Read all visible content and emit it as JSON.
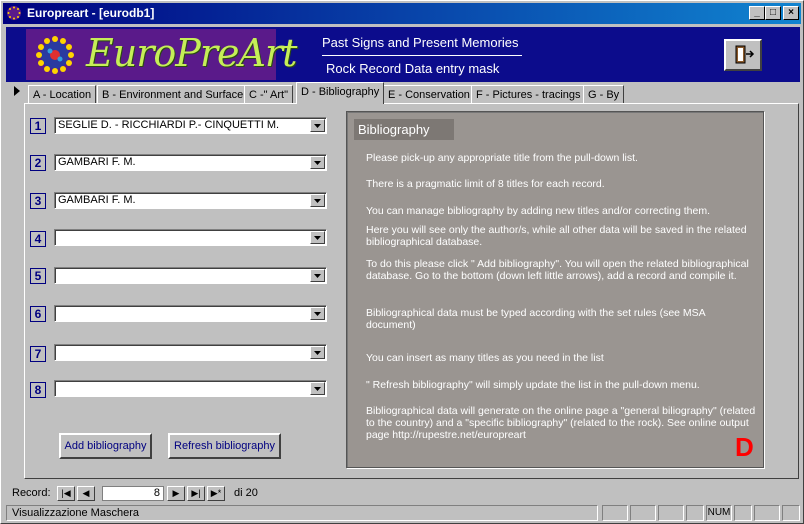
{
  "window": {
    "title": "Europreart - [eurodb1]"
  },
  "banner": {
    "logo_text": "EuroPreArt",
    "line1": "Past Signs and Present Memories",
    "line2": "Rock Record Data entry mask"
  },
  "tabs": [
    {
      "label": "A - Location"
    },
    {
      "label": "B - Environment and Surface"
    },
    {
      "label": "C -\" Art\""
    },
    {
      "label": "D - Bibliography",
      "active": true
    },
    {
      "label": "E - Conservation"
    },
    {
      "label": "F - Pictures - tracings"
    },
    {
      "label": "G - By"
    }
  ],
  "bibliography": {
    "rows": [
      {
        "num": "1",
        "value": "SEGLIE D. - RICCHIARDI P.- CINQUETTI M."
      },
      {
        "num": "2",
        "value": "GAMBARI F. M."
      },
      {
        "num": "3",
        "value": "GAMBARI F. M."
      },
      {
        "num": "4",
        "value": ""
      },
      {
        "num": "5",
        "value": ""
      },
      {
        "num": "6",
        "value": ""
      },
      {
        "num": "7",
        "value": ""
      },
      {
        "num": "8",
        "value": ""
      }
    ],
    "add_button": "Add bibliography",
    "refresh_button": "Refresh bibliography"
  },
  "info": {
    "header": "Bibliography",
    "paragraphs": [
      "Please pick-up any appropriate title from the pull-down list.",
      "There is a pragmatic limit of 8 titles for each record.",
      "You can manage bibliography by adding new titles and/or correcting them.",
      "Here you will see only the author/s, while all other data will be saved in the related  bibliographical database.",
      "To do this please click \" Add bibliography\". You will open the related bibliographical database. Go to the bottom (down left little arrows), add a record and compile it.",
      "Bibliographical data must be typed according with the set rules  (see MSA document)",
      "You can insert as many titles as you need in the list",
      "\" Refresh bibliography\" will simply update the list in the pull-down menu.",
      "Bibliographical data will generate on the online page a \"general biliography\" (related to the country) and a \"specific bibliography\" (related to the rock). See online output page http://rupestre.net/europreart"
    ],
    "section_letter": "D"
  },
  "navigation": {
    "label": "Record:",
    "current": "8",
    "total": "di 20"
  },
  "status": {
    "text": "Visualizzazione Maschera",
    "num": "NUM"
  }
}
